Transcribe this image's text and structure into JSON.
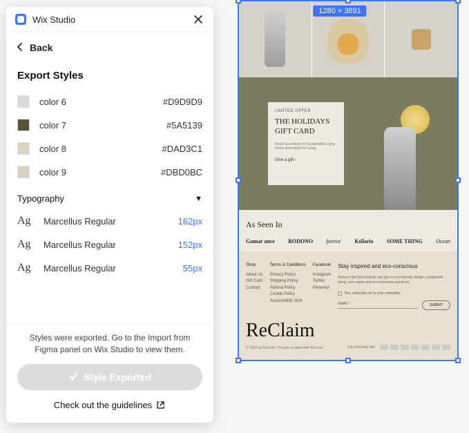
{
  "panel": {
    "app_title": "Wix Studio",
    "back_label": "Back",
    "section_title": "Export Styles",
    "colors": [
      {
        "name": "color 6",
        "hex": "#D9D9D9"
      },
      {
        "name": "color 7",
        "hex": "#5A5139"
      },
      {
        "name": "color 8",
        "hex": "#DAD3C1"
      },
      {
        "name": "color 9",
        "hex": "#DBD0BC"
      }
    ],
    "typography_label": "Typography",
    "fonts": [
      {
        "name": "Marcellus Regular",
        "size": "162px"
      },
      {
        "name": "Marcellus Regular",
        "size": "152px"
      },
      {
        "name": "Marcellus Regular",
        "size": "55px"
      }
    ],
    "export_message": "Styles were exported. Go to the Import from Figma panel on Wix Studio to view them.",
    "exported_button": "Style Exported",
    "guidelines": "Check out the guidelines"
  },
  "canvas": {
    "size_badge": "1280 × 3691",
    "card": {
      "tag": "LIMITED OFFER",
      "title": "THE HOLIDAYS GIFT CARD",
      "desc": "Home Essentials for Sustainable Living Home Essentials for Living.",
      "link": "Give a gift  ›"
    },
    "seen_title": "As Seen In",
    "brands": [
      "Gamar ance",
      "RODONO",
      "foreva'",
      "Ktilario",
      "SOME THING",
      "Ocean"
    ],
    "footer": {
      "cols": [
        {
          "head": "Shop",
          "items": [
            "About Us",
            "Gift Card",
            "Contact"
          ]
        },
        {
          "head": "Terms & Conditions",
          "items": [
            "Privacy Policy",
            "Shipping Policy",
            "Refund Policy",
            "Cookie Policy",
            "Accessibility Stmt"
          ]
        },
        {
          "head": "Facebook",
          "items": [
            "Instagram",
            "Twitter",
            "Pinterest"
          ]
        }
      ],
      "news_title": "Stay inspired and eco-conscious",
      "news_desc": "Receive the latest trends and tips on eco-friendly design, sustainable living, zero waste and eco-conscious practices.",
      "checkbox": "Yes, subscribe me to your newsletter.",
      "email_label": "EMAIL *",
      "submit": "SUBMIT"
    },
    "brandmark": "ReClaim",
    "copyright": "© 2025 by ReClaim. Proudly created with Wix.com",
    "pay_label": "Pay Securely with"
  }
}
